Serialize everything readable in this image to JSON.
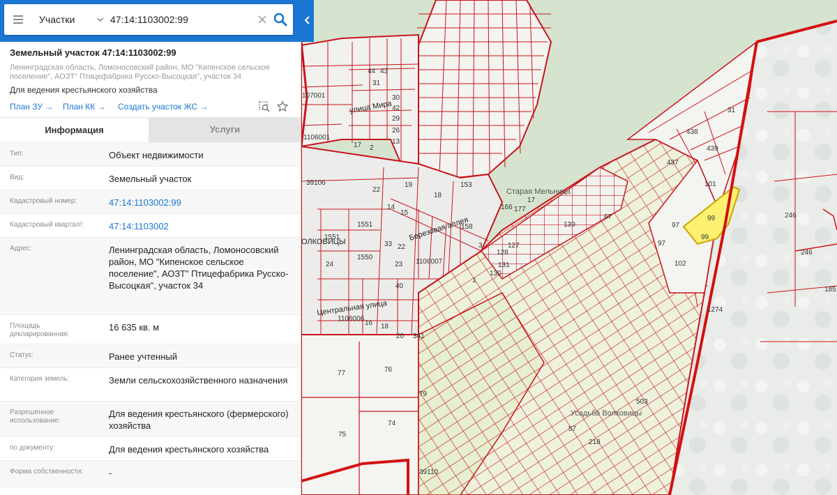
{
  "search": {
    "type_label": "Участки",
    "query": "47:14:1103002:99"
  },
  "parcel": {
    "title": "Земельный участок 47:14:1103002:99",
    "address": "Ленинградская область, Ломоносовский район, МО \"Кипенское сельское поселение\", АОЗТ\" Птицефабрика Русско-Высоцкая\", участок 34",
    "purpose": "Для ведения крестьянского хозяйства",
    "links": {
      "plan_zu": "План ЗУ →",
      "plan_kk": "План КК →",
      "create_zhs": "Создать участок ЖС →"
    }
  },
  "tabs": {
    "info": "Информация",
    "services": "Услуги"
  },
  "info_rows": [
    {
      "label": "Тип:",
      "value": "Объект недвижимости"
    },
    {
      "label": "Вид:",
      "value": "Земельный участок"
    },
    {
      "label": "Кадастровый номер:",
      "value": "47:14:1103002:99"
    },
    {
      "label": "Кадастровый квартал!:",
      "value": "47:14:1103002"
    },
    {
      "label": "Адрес:",
      "value": "Ленинградская область, Ломоносовский район, МО \"Кипенское сельское поселение\", АОЗТ\" Птицефабрика Русско-Высоцкая\", участок 34"
    },
    {
      "label": "Площадь декларированная:",
      "value": "16 635 кв. м"
    },
    {
      "label": "Статус:",
      "value": "Ранее учтенный"
    },
    {
      "label": "Категория земель:",
      "value": "Земли сельскохозяйственного назначения"
    },
    {
      "label": "Разрешенное использование:",
      "value": "Для ведения крестьянского (фермерского) хозяйства"
    },
    {
      "label": "по документу:",
      "value": "Для ведения крестьянского хозяйства"
    },
    {
      "label": "Форма собственности:",
      "value": "-"
    }
  ],
  "map": {
    "streets": [
      "улица Мира",
      "Старая Мельница",
      "Березовая аллея",
      "Центральная улица",
      "Усадьба Волковицы",
      "ОЛКОВИЦЫ"
    ],
    "block_labels": [
      "107001",
      "1106001",
      "39106",
      "1106007",
      "1106006",
      "39110"
    ],
    "parcel_labels": [
      "44",
      "43",
      "31",
      "30",
      "42",
      "29",
      "26",
      "13",
      "17",
      "2",
      "22",
      "19",
      "18",
      "153",
      "14",
      "15",
      "158",
      "166",
      "177",
      "17",
      "1551",
      "1550",
      "24",
      "33",
      "22",
      "23",
      "40",
      "1",
      "3",
      "128",
      "127",
      "130",
      "131",
      "139",
      "67",
      "31",
      "438",
      "439",
      "437",
      "101",
      "99",
      "99",
      "97",
      "97",
      "102",
      "246",
      "246",
      "185",
      "1274",
      "77",
      "76",
      "79",
      "74",
      "75",
      "503",
      "57",
      "218",
      "20",
      "18",
      "16",
      "341"
    ],
    "colors": {
      "parcel_border": "#c8141e",
      "selected_fill": "#fff170",
      "selected_border": "#a08c00",
      "boundary": "#d41010",
      "forest": "#cfe0c5",
      "field": "#e3efcf"
    }
  }
}
